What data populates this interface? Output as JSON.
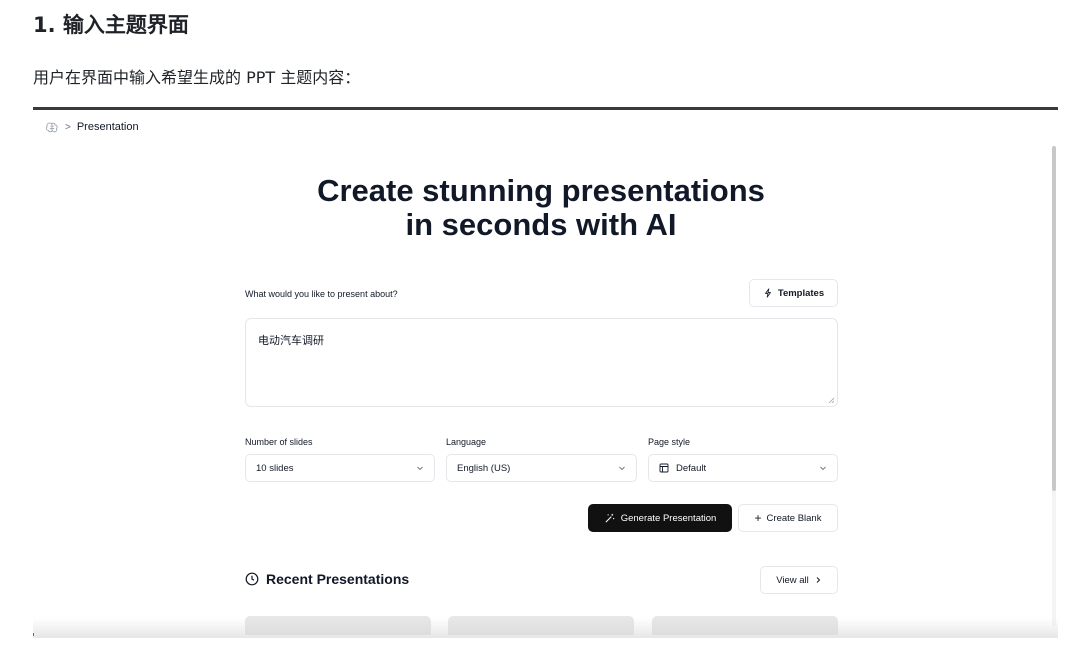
{
  "doc": {
    "heading": "1. 输入主题界面",
    "paragraph": "用户在界面中输入希望生成的 PPT 主题内容："
  },
  "app": {
    "breadcrumb": {
      "separator": ">",
      "current": "Presentation"
    },
    "hero": {
      "line1": "Create stunning presentations",
      "line2": "in seconds with AI"
    },
    "prompt": {
      "label": "What would you like to present about?",
      "value": "电动汽车调研",
      "templates_label": "Templates"
    },
    "options": {
      "slides": {
        "label": "Number of slides",
        "value": "10 slides"
      },
      "language": {
        "label": "Language",
        "value": "English (US)"
      },
      "page_style": {
        "label": "Page style",
        "value": "Default"
      }
    },
    "actions": {
      "generate_label": "Generate Presentation",
      "create_blank_label": "Create Blank"
    },
    "recent": {
      "title": "Recent Presentations",
      "view_all_label": "View all"
    },
    "icons": {
      "logo": "brain-icon",
      "templates": "sparkle-icon",
      "generate": "magic-wand-icon",
      "create_blank": "plus-icon",
      "page_style": "layout-icon",
      "recent": "clock-icon",
      "view_all": "chevron-right-icon"
    },
    "colors": {
      "primary_button": "#111111",
      "border": "#e5e7eb",
      "card_placeholder": "#e7e7e7"
    }
  }
}
